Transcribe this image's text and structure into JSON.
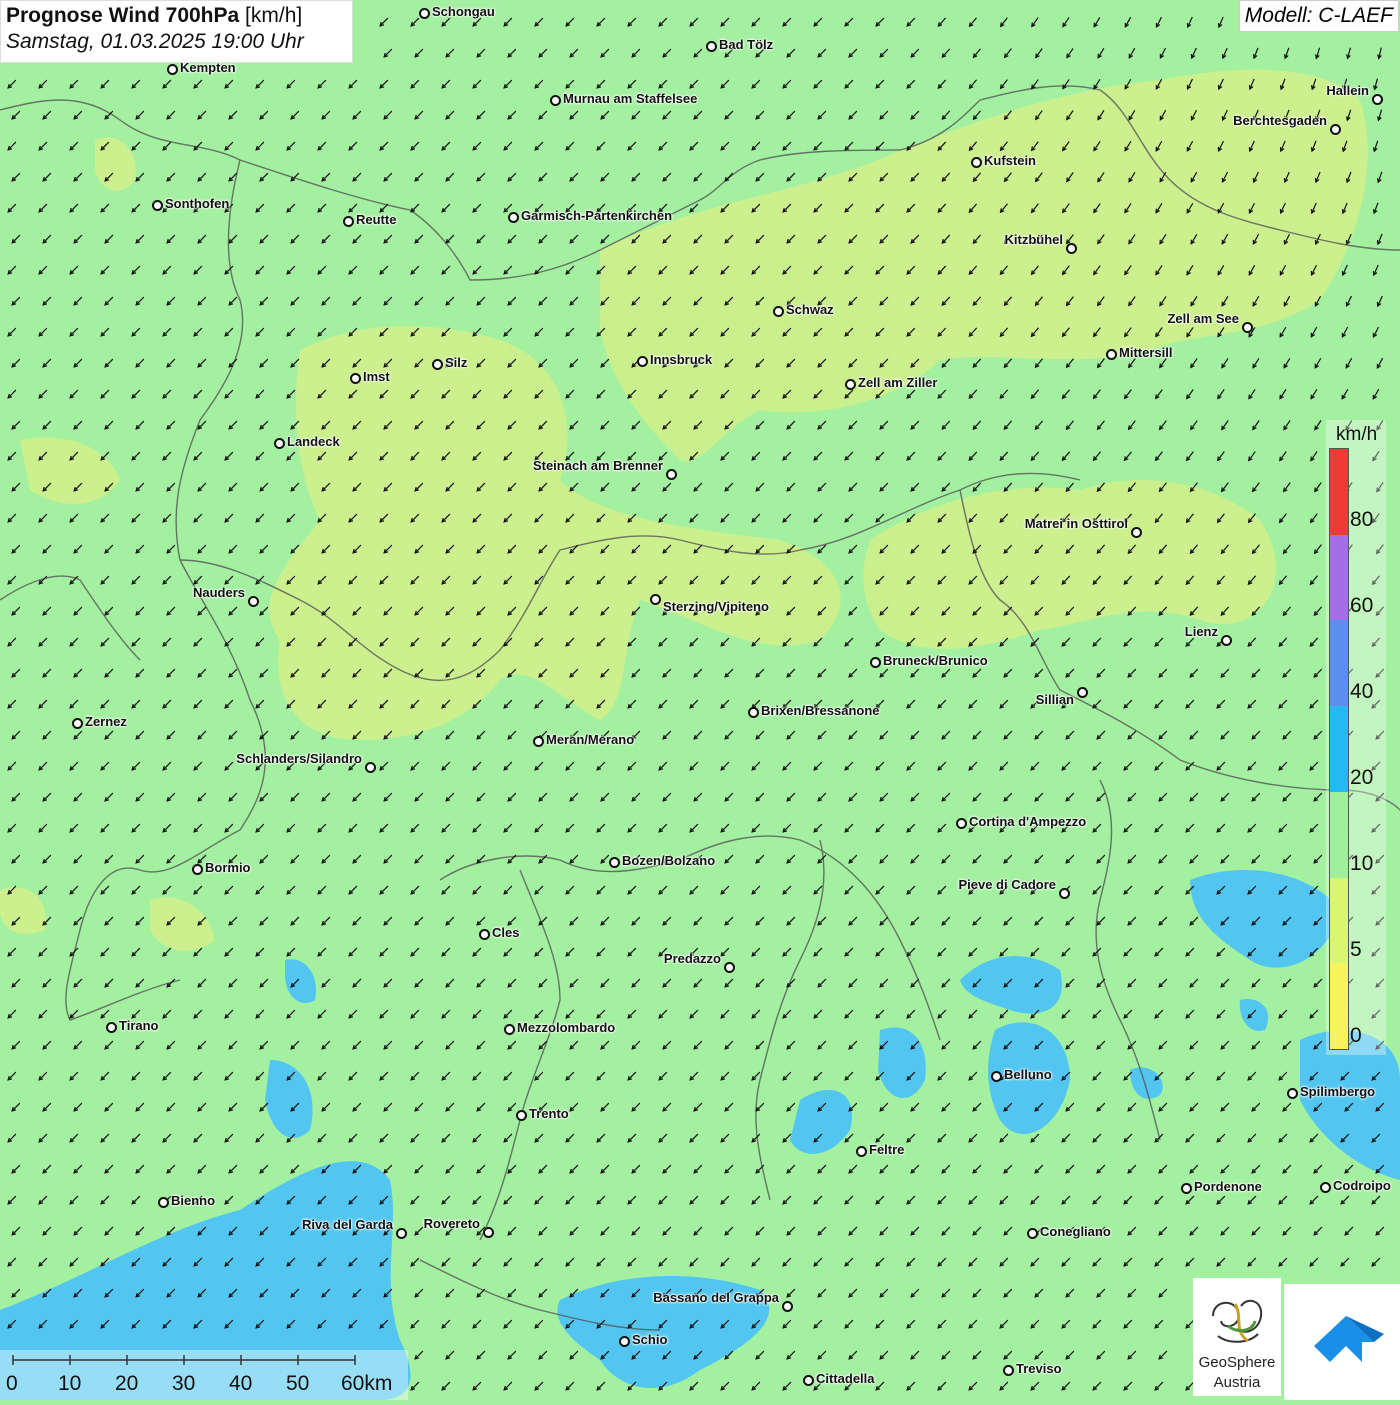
{
  "header": {
    "title_bold": "Prognose Wind 700hPa",
    "title_unit": " [km/h]",
    "datetime": "Samstag, 01.03.2025 19:00 Uhr",
    "model": "Modell: C-LAEF"
  },
  "legend": {
    "unit": "km/h",
    "ticks": [
      "80",
      "60",
      "40",
      "20",
      "10",
      "5",
      "0"
    ],
    "colors": [
      "#ef3a35",
      "#a46ee8",
      "#5c8ef0",
      "#26b8f2",
      "#9ef09c",
      "#d8f76e",
      "#f6f35e"
    ]
  },
  "colors": {
    "background_green": "#a3f0a0",
    "yellow_zone": "#cdef8c",
    "blue_zone": "#52c6f0",
    "border_lines": "#555555"
  },
  "cities": [
    {
      "name": "Schongau"
    },
    {
      "name": "Bad Tölz"
    },
    {
      "name": "Kempten"
    },
    {
      "name": "Murnau am Staffelsee"
    },
    {
      "name": "Hallein"
    },
    {
      "name": "Berchtesgaden"
    },
    {
      "name": "Kufstein"
    },
    {
      "name": "Sonthofen"
    },
    {
      "name": "Reutte"
    },
    {
      "name": "Garmisch-Partenkirchen"
    },
    {
      "name": "Kitzbühel"
    },
    {
      "name": "Schwaz"
    },
    {
      "name": "Zell am See"
    },
    {
      "name": "Mittersill"
    },
    {
      "name": "Silz"
    },
    {
      "name": "Innsbruck"
    },
    {
      "name": "Imst"
    },
    {
      "name": "Zell am Ziller"
    },
    {
      "name": "Landeck"
    },
    {
      "name": "Steinach am Brenner"
    },
    {
      "name": "Matrei in Osttirol"
    },
    {
      "name": "Nauders"
    },
    {
      "name": "Sterzing/Vipiteno"
    },
    {
      "name": "Lienz"
    },
    {
      "name": "Bruneck/Brunico"
    },
    {
      "name": "Sillian"
    },
    {
      "name": "Brixen/Bressanone"
    },
    {
      "name": "Zernez"
    },
    {
      "name": "Meran/Merano"
    },
    {
      "name": "Schlanders/Silandro"
    },
    {
      "name": "Cortina d'Ampezzo"
    },
    {
      "name": "Bozen/Bolzano"
    },
    {
      "name": "Bormio"
    },
    {
      "name": "Pieve di Cadore"
    },
    {
      "name": "Cles"
    },
    {
      "name": "Predazzo"
    },
    {
      "name": "Tirano"
    },
    {
      "name": "Mezzolombardo"
    },
    {
      "name": "Belluno"
    },
    {
      "name": "Spilimbergo"
    },
    {
      "name": "Trento"
    },
    {
      "name": "Feltre"
    },
    {
      "name": "Pordenone"
    },
    {
      "name": "Codroipo"
    },
    {
      "name": "Bienno"
    },
    {
      "name": "Riva del Garda"
    },
    {
      "name": "Rovereto"
    },
    {
      "name": "Conegliano"
    },
    {
      "name": "Bassano del Grappa"
    },
    {
      "name": "Schio"
    },
    {
      "name": "Treviso"
    },
    {
      "name": "Cittadella"
    }
  ],
  "scalebar": {
    "labels": [
      "0",
      "10",
      "20",
      "30",
      "40",
      "50",
      "60km"
    ]
  },
  "logos": {
    "geosphere_line1": "GeoSphere",
    "geosphere_line2": "Austria",
    "geosphere_icon": "geosphere-swirl-icon",
    "brand_icon": "blue-house-arrow-icon"
  }
}
